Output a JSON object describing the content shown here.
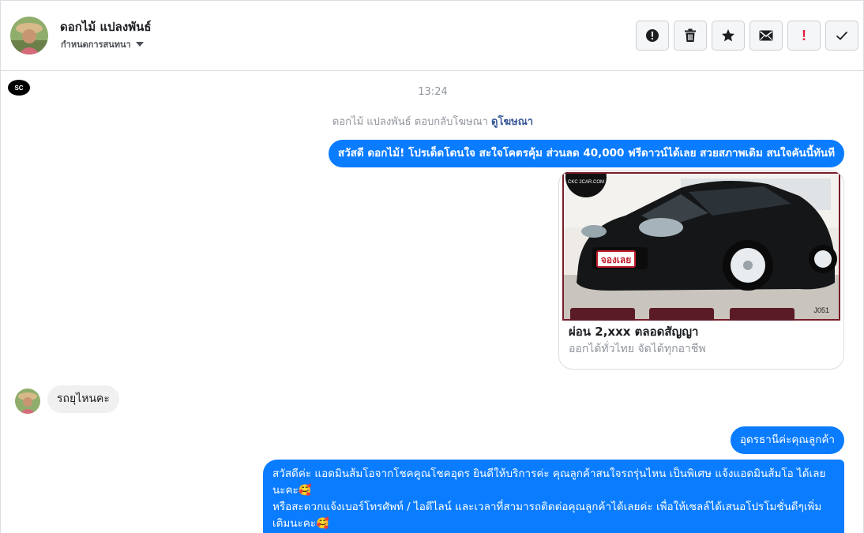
{
  "header": {
    "contact_name": "ดอกไม้ แปลงพันธ์",
    "assign_label": "กำหนดการสนทนา",
    "actions": [
      {
        "name": "report-button",
        "icon": "alert-circle-icon"
      },
      {
        "name": "delete-button",
        "icon": "trash-icon"
      },
      {
        "name": "star-button",
        "icon": "star-icon"
      },
      {
        "name": "mark-unread-button",
        "icon": "envelope-icon"
      },
      {
        "name": "mark-spam-button",
        "icon": "exclamation-icon",
        "glyph": "!"
      },
      {
        "name": "mark-done-button",
        "icon": "check-icon"
      }
    ]
  },
  "conversation": {
    "timestamp": "13:24",
    "reply_note": {
      "text": "ดอกไม้ แปลงพันธ์ ตอบกลับโฆษณา",
      "link": "ดูโฆษณา"
    },
    "messages": {
      "promo": "สวัสดี ดอกไม้! โปรเด็ดโดนใจ สะใจโคตรคุ้ม ส่วนลด 40,000 ฟรีดาวน์ได้เลย สวยสภาพเดิม สนใจคันนี้ทันที",
      "ad_card": {
        "image_watermark": "CKC 2CAR.COM",
        "image_badge": "จองเลย",
        "image_code": "J051",
        "title": "ผ่อน 2,xxx ตลอดสัญญา",
        "subtitle": "ออกได้ทั่วไทย จัดได้ทุกอาชีพ"
      },
      "incoming": "รถยุไหนคะ",
      "reply_location": "อุดรธานีค่ะคุณลูกค้า",
      "reply_long_line1": "สวัสดีค่ะ แอดมินส้มโอจากโชคคูณโชคอุดร ยินดีให้บริการค่ะ   คุณลูกค้าสนใจรถรุ่นไหน เป็นพิเศษ แจ้งแอดมินส้มโอ ได้เลยนะคะ🥰",
      "reply_long_line2": "หรือสะดวกแจ้งเบอร์โทรศัพท์ / ไอดีไลน์ และเวลาที่สามารถติดต่อคุณลูกค้าได้เลยค่ะ เพื่อให้เซลล์ได้เสนอโปรโมชั่นดีๆเพิ่มเติมนะคะ🥰"
    }
  },
  "colors": {
    "outgoing_bubble": "#0a7cff",
    "incoming_bubble": "#f1f0f0",
    "link": "#385898",
    "spam": "#e41e3f"
  }
}
